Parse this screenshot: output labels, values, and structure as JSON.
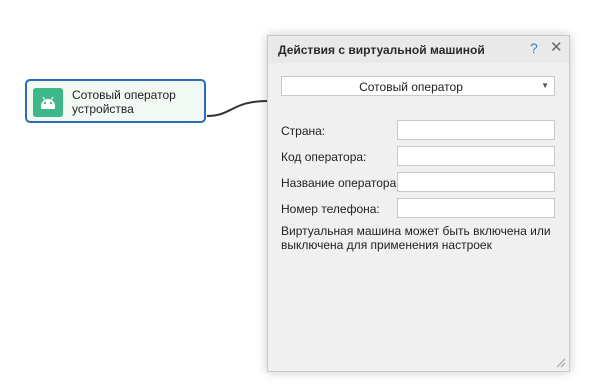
{
  "node": {
    "label": "Сотовый оператор устройства",
    "icon": "android-icon",
    "icon_color": "#3cb88a",
    "border_color": "#2a6db3"
  },
  "dialog": {
    "title": "Действия с виртуальной машиной",
    "help_label": "?",
    "close_label": "✕",
    "action_select": {
      "value": "Сотовый оператор"
    },
    "fields": [
      {
        "label": "Страна:",
        "value": ""
      },
      {
        "label": "Код оператора:",
        "value": ""
      },
      {
        "label": "Название оператора:",
        "value": ""
      },
      {
        "label": "Номер телефона:",
        "value": ""
      }
    ],
    "note": "Виртуальная машина может быть включена или выключена для применения настроек"
  }
}
